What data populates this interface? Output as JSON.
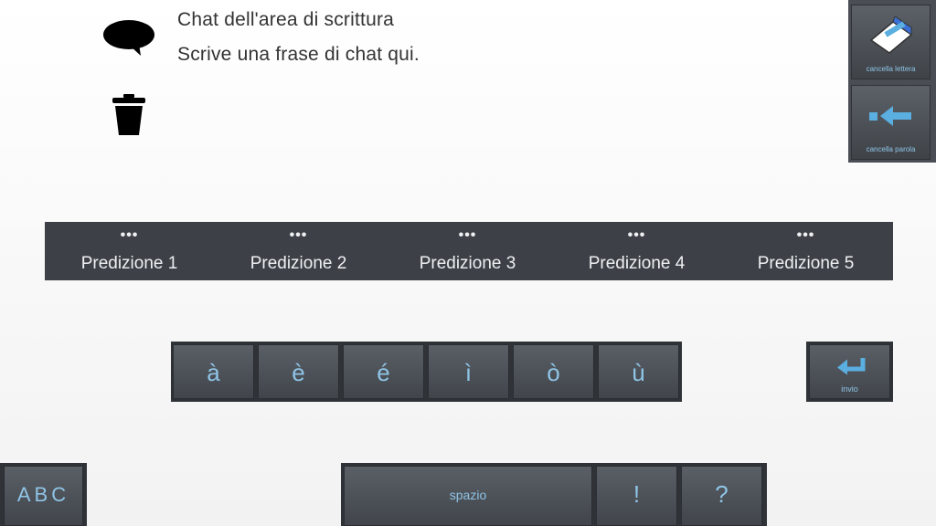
{
  "chat": {
    "title": "Chat dell'area di scrittura",
    "text": "Scrive una frase di chat qui."
  },
  "side_buttons": {
    "delete_letter": "cancella lettera",
    "delete_word": "cancella parola"
  },
  "predictions": [
    {
      "dots": "•••",
      "label": "Predizione 1"
    },
    {
      "dots": "•••",
      "label": "Predizione 2"
    },
    {
      "dots": "•••",
      "label": "Predizione 3"
    },
    {
      "dots": "•••",
      "label": "Predizione 4"
    },
    {
      "dots": "•••",
      "label": "Predizione 5"
    }
  ],
  "accent_keys": [
    "à",
    "è",
    "é",
    "ì",
    "ò",
    "ù"
  ],
  "enter_key": {
    "label": "invio"
  },
  "bottom": {
    "abc": "ABC",
    "space": "spazio",
    "exclamation": "!",
    "question": "?"
  },
  "colors": {
    "key_text": "#8fc4e6",
    "key_bg": "#4a4e54",
    "icon_blue": "#5aaee0"
  }
}
